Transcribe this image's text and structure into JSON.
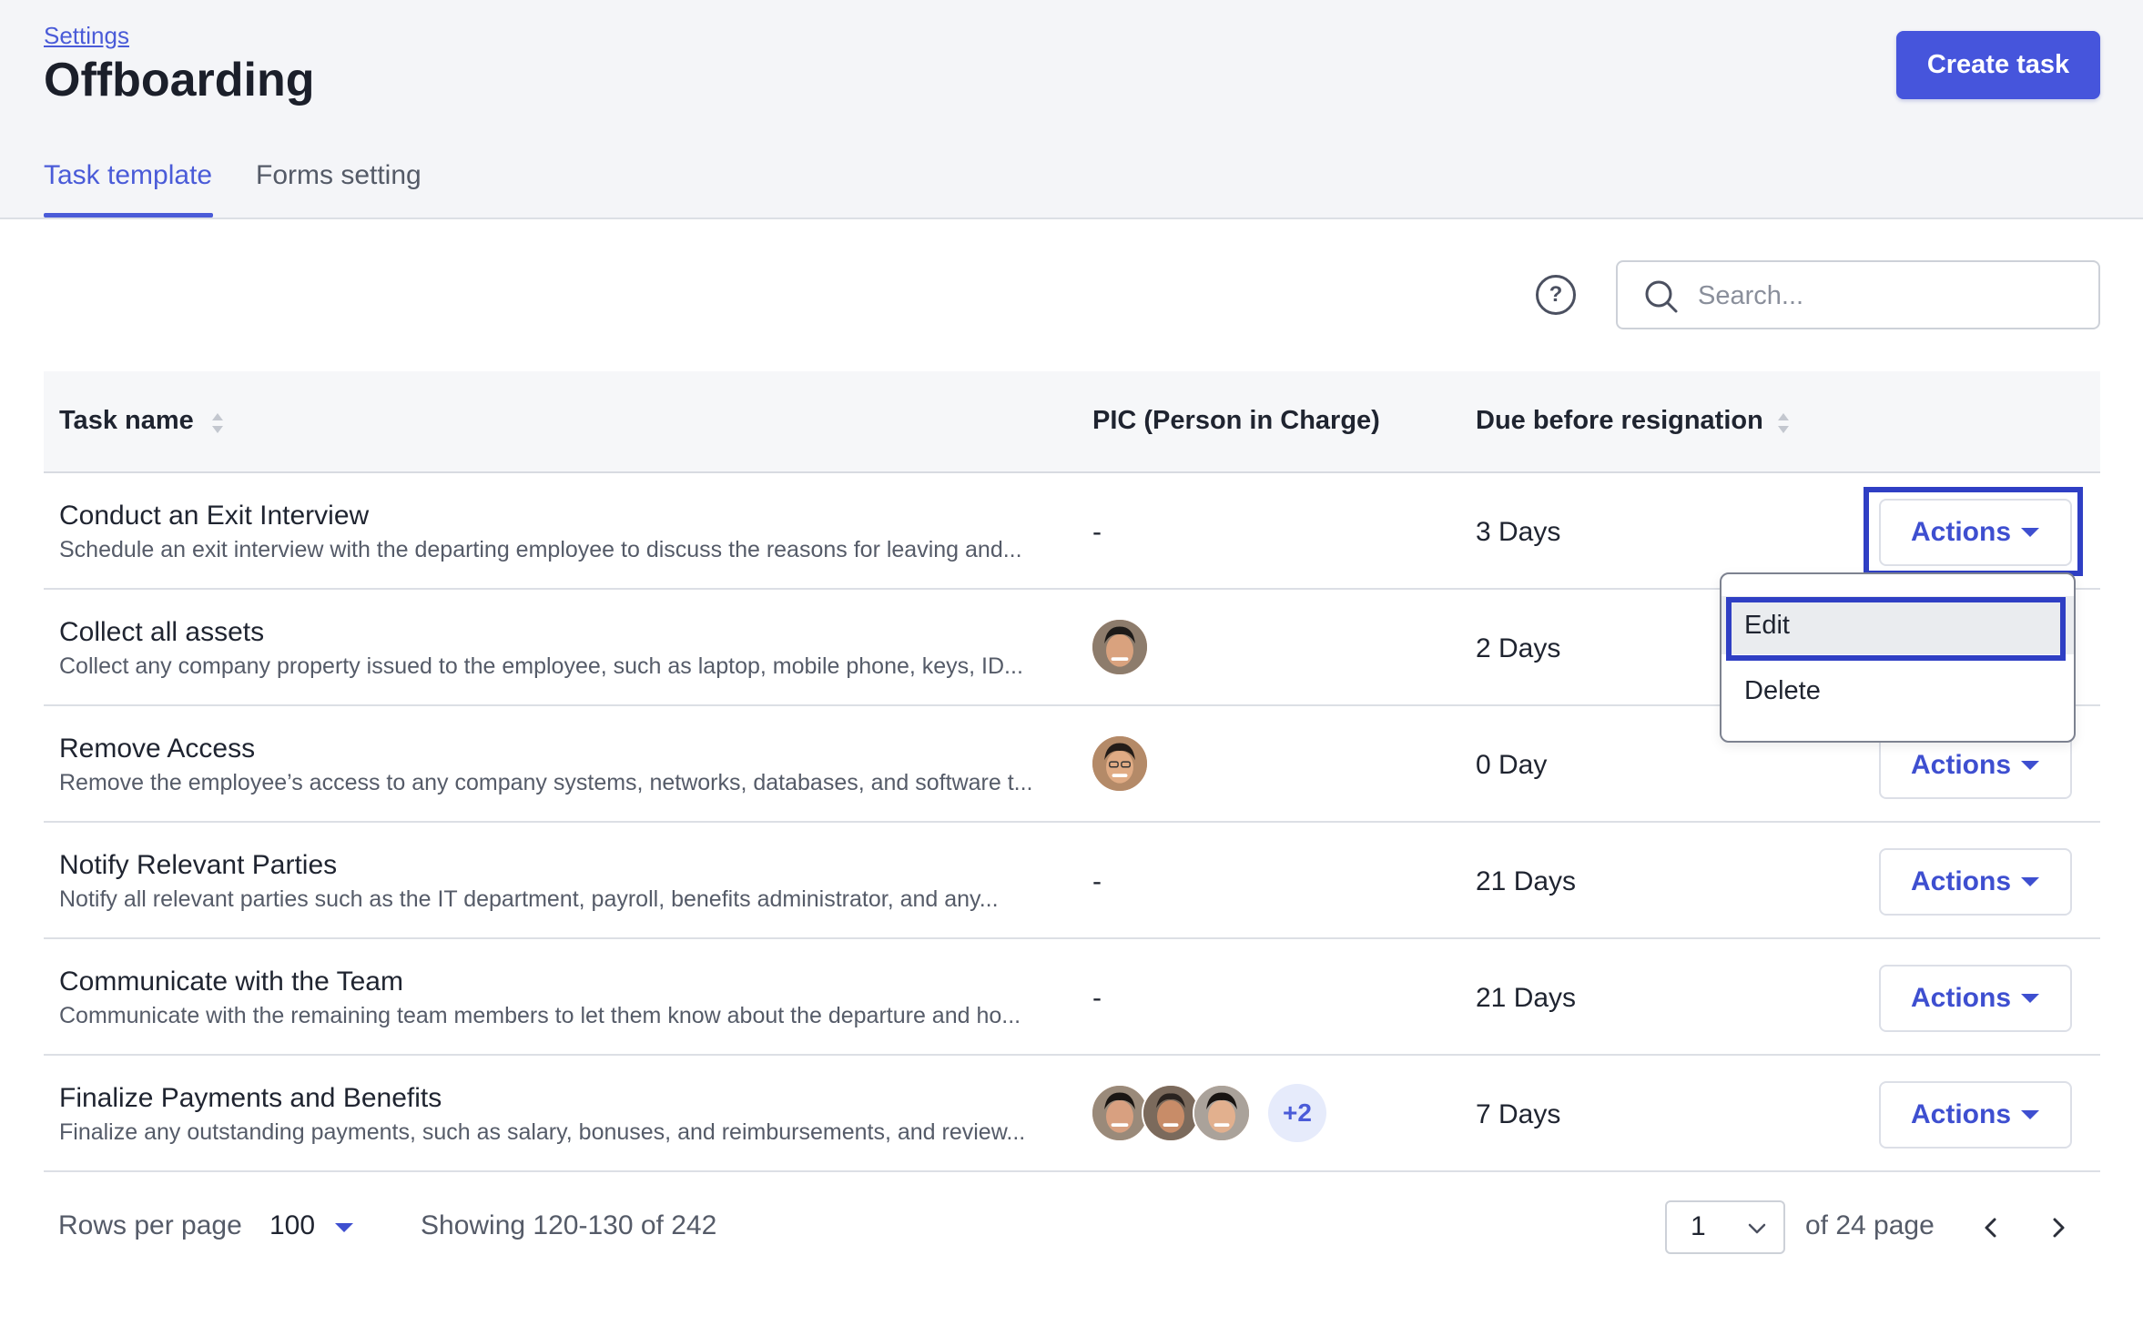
{
  "header": {
    "breadcrumb": "Settings",
    "title": "Offboarding",
    "create_button": "Create task"
  },
  "tabs": [
    {
      "label": "Task template",
      "active": true
    },
    {
      "label": "Forms setting",
      "active": false
    }
  ],
  "toolbar": {
    "help_icon": "question-circle-icon",
    "search_placeholder": "Search..."
  },
  "table": {
    "columns": [
      "Task name",
      "PIC (Person in Charge)",
      "Due before resignation"
    ],
    "rows": [
      {
        "title": "Conduct an Exit Interview",
        "description": "Schedule an exit interview with the departing employee to discuss the reasons for leaving and...",
        "pic": "-",
        "due": "3 Days",
        "action": "Actions"
      },
      {
        "title": "Collect all assets",
        "description": "Collect any company property issued to the employee, such as laptop, mobile phone, keys, ID...",
        "pic": "avatar",
        "due": "2 Days",
        "action": "Actions"
      },
      {
        "title": "Remove Access",
        "description": "Remove the employee’s access to any company systems, networks, databases, and software t...",
        "pic": "avatar",
        "due": "0 Day",
        "action": "Actions"
      },
      {
        "title": "Notify Relevant Parties",
        "description": "Notify all relevant parties such as the IT department, payroll, benefits administrator, and any...",
        "pic": "-",
        "due": "21 Days",
        "action": "Actions"
      },
      {
        "title": "Communicate with the Team",
        "description": "Communicate with the remaining team members to let them know about the departure and ho...",
        "pic": "-",
        "due": "21 Days",
        "action": "Actions"
      },
      {
        "title": "Finalize Payments and Benefits",
        "description": "Finalize any outstanding payments, such as salary, bonuses, and reimbursements, and review...",
        "pic": "avatars",
        "pic_more": "+2",
        "due": "7 Days",
        "action": "Actions"
      }
    ]
  },
  "dropdown": {
    "items": [
      "Edit",
      "Delete"
    ]
  },
  "footer": {
    "rows_per_page_label": "Rows per page",
    "rows_per_page_value": "100",
    "showing": "Showing 120-130 of 242",
    "page_value": "1",
    "page_of": "of 24 page"
  },
  "colors": {
    "accent": "#4655dc",
    "focus_outline": "#2f3fc4"
  }
}
